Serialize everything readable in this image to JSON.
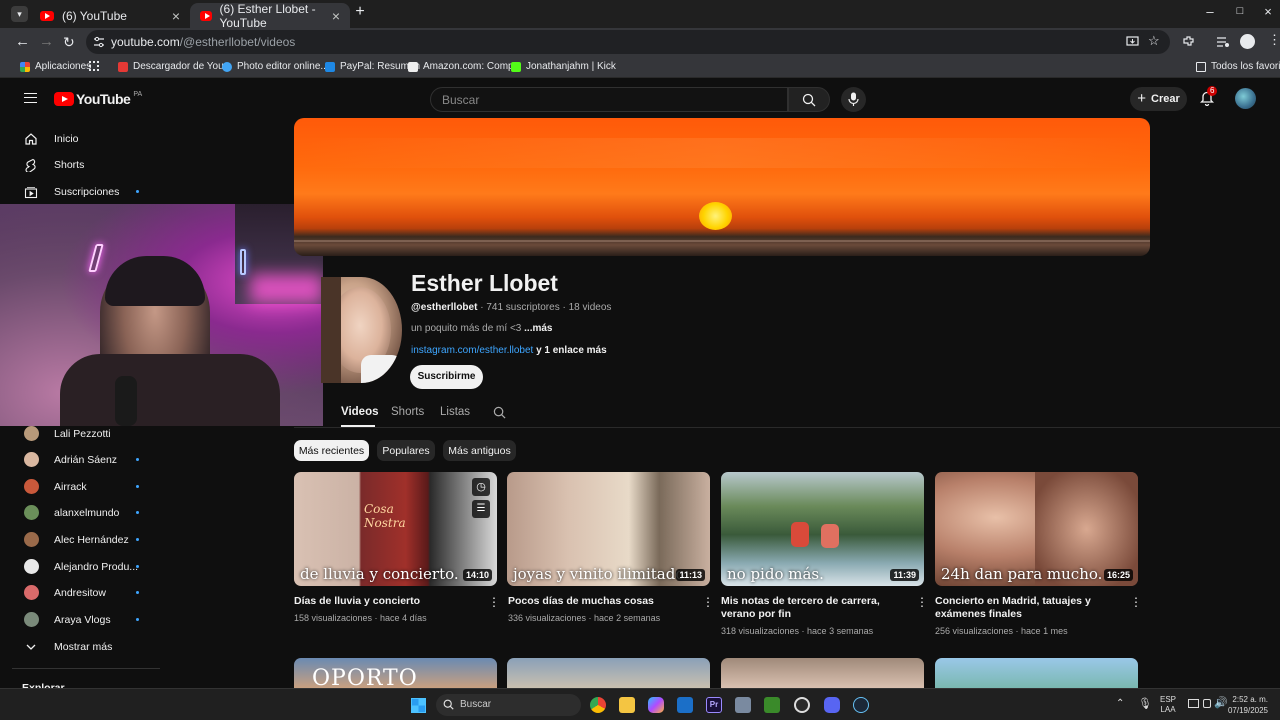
{
  "browser": {
    "tabs": [
      {
        "label": "(6) YouTube",
        "active": false
      },
      {
        "label": "(6) Esther Llobet - YouTube",
        "active": true
      }
    ],
    "new_tab_glyph": "+",
    "url_host": "youtube.com",
    "url_path": "/@estherllobet/videos",
    "bookmarks": [
      {
        "label": "Aplicaciones",
        "icon": "apps-grid-icon",
        "color": "#4285f4"
      },
      {
        "label": "Descargador de You...",
        "icon": "descargador-icon",
        "color": "#e53935"
      },
      {
        "label": "Photo editor online...",
        "icon": "photo-editor-icon",
        "color": "#42a5f5"
      },
      {
        "label": "PayPal: Resumen",
        "icon": "paypal-icon",
        "color": "#1e88e5"
      },
      {
        "label": "Amazon.com: Comp...",
        "icon": "amazon-icon",
        "color": "#eeeeee"
      },
      {
        "label": "Jonathanjahm | Kick",
        "icon": "kick-icon",
        "color": "#53fc18"
      }
    ],
    "bookmarks_folder": "Todos los favoritos"
  },
  "youtube": {
    "logo_text": "YouTube",
    "region": "PA",
    "search_placeholder": "Buscar",
    "create_label": "Crear",
    "notification_count": "6"
  },
  "sidebar": {
    "top": [
      {
        "label": "Inicio",
        "icon": "home-icon",
        "dot": false
      },
      {
        "label": "Shorts",
        "icon": "shorts-icon",
        "dot": false
      },
      {
        "label": "Suscripciones",
        "icon": "subscriptions-icon",
        "dot": true
      }
    ],
    "subscriptions": [
      {
        "label": "Lali Pezzotti",
        "dot": false,
        "color": "#b89a7a"
      },
      {
        "label": "Adrián Sáenz",
        "dot": true,
        "color": "#d9b7a0"
      },
      {
        "label": "Airrack",
        "dot": true,
        "color": "#c9593b"
      },
      {
        "label": "alanxelmundo",
        "dot": true,
        "color": "#6b8f5a"
      },
      {
        "label": "Alec Hernández",
        "dot": true,
        "color": "#9a6a4a"
      },
      {
        "label": "Alejandro Produ...",
        "dot": true,
        "color": "#e8e8e8"
      },
      {
        "label": "Andresitow",
        "dot": true,
        "color": "#d96a6a"
      },
      {
        "label": "Araya Vlogs",
        "dot": true,
        "color": "#7a8a7a"
      }
    ],
    "show_more": "Mostrar más",
    "explore_heading": "Explorar"
  },
  "channel": {
    "name": "Esther Llobet",
    "handle": "@estherllobet",
    "subscribers": "741 suscriptores",
    "videos_count": "18 videos",
    "description": "un poquito más de mí <3",
    "more": "...más",
    "link": "instagram.com/esther.llobet",
    "link_more": "y 1 enlace más",
    "subscribe": "Suscribirme",
    "tabs": [
      "Videos",
      "Shorts",
      "Listas"
    ]
  },
  "filters": [
    "Más recientes",
    "Populares",
    "Más antiguos"
  ],
  "videos": [
    {
      "title": "Días de lluvia y concierto",
      "views": "158 visualizaciones",
      "age": "hace 4 días",
      "duration": "14:10",
      "caption": "de lluvia y concierto."
    },
    {
      "title": "Pocos días de muchas cosas",
      "views": "336 visualizaciones",
      "age": "hace 2 semanas",
      "duration": "11:13",
      "caption": "joyas y vinito ilimitado"
    },
    {
      "title": "Mis notas de tercero de carrera, verano por fin",
      "views": "318 visualizaciones",
      "age": "hace 3 semanas",
      "duration": "11:39",
      "caption": "no pido más."
    },
    {
      "title": "Concierto en Madrid, tatuajes y exámenes finales",
      "views": "256 visualizaciones",
      "age": "hace 1 mes",
      "duration": "16:25",
      "caption": "24h dan para mucho."
    }
  ],
  "next_row_caption": "OPORTO",
  "taskbar": {
    "search_placeholder": "Buscar",
    "lang_top": "ESP",
    "lang_bottom": "LAA",
    "time": "2:52 a. m.",
    "date": "07/19/2025"
  },
  "colors": {
    "youtube_red": "#ff0000",
    "link_blue": "#3ea6ff",
    "banner_orange": "#ff6a0d"
  }
}
